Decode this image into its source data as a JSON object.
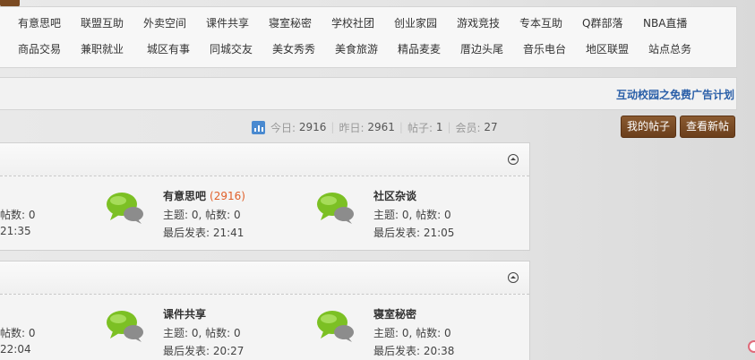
{
  "nav": {
    "row1": [
      "有意思吧",
      "联盟互助",
      "外卖空间",
      "课件共享",
      "寝室秘密",
      "学校社团",
      "创业家园",
      "游戏竞技",
      "专本互助",
      "Q群部落",
      "NBA直播"
    ],
    "row2": [
      "商品交易",
      "兼职就业",
      "城区有事",
      "同城交友",
      "美女秀秀",
      "美食旅游",
      "精品麦麦",
      "厝边头尾",
      "音乐电台",
      "地区联盟",
      "站点总务"
    ]
  },
  "ad": {
    "text": "互动校园之免费广告计划"
  },
  "stats": {
    "today_label": "今日:",
    "today_value": "2916",
    "yesterday_label": "昨日:",
    "yesterday_value": "2961",
    "posts_label": "帖子:",
    "posts_value": "1",
    "members_label": "会员:",
    "members_value": "27"
  },
  "buttons": {
    "my_posts": "我的帖子",
    "new_posts": "查看新帖"
  },
  "section1": {
    "left_partial": {
      "counts": "帖数: 0",
      "last": "21:35"
    },
    "forums": [
      {
        "name": "有意思吧",
        "today": "(2916)",
        "topics": "主题: 0, 帖数: 0",
        "last": "最后发表: 21:41"
      },
      {
        "name": "社区杂谈",
        "today": "",
        "topics": "主题: 0, 帖数: 0",
        "last": "最后发表: 21:05"
      }
    ]
  },
  "section2": {
    "left_partial": {
      "counts": "帖数: 0",
      "last": "22:04"
    },
    "forums": [
      {
        "name": "课件共享",
        "today": "",
        "topics": "主题: 0, 帖数: 0",
        "last": "最后发表: 20:27"
      },
      {
        "name": "寝室秘密",
        "today": "",
        "topics": "主题: 0, 帖数: 0",
        "last": "最后发表: 20:38"
      }
    ]
  },
  "colors": {
    "brand_brown": "#6b3f1c",
    "link_blue": "#2a5fa8",
    "today_orange": "#e0602a",
    "bubble_green": "#7cc024"
  }
}
